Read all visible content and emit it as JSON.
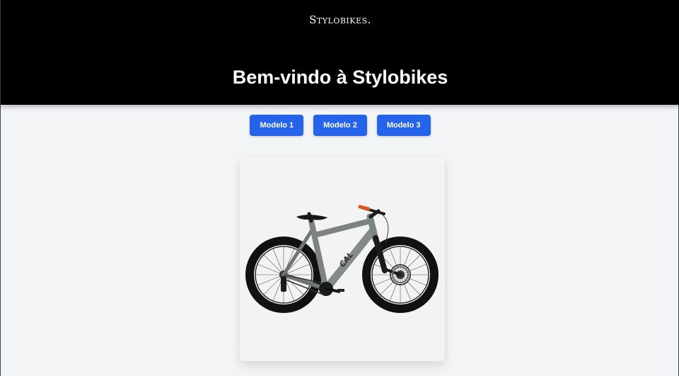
{
  "brand": {
    "logo_text": "Stylobikes."
  },
  "hero": {
    "title": "Bem-vindo à Stylobikes"
  },
  "nav": {
    "buttons": [
      {
        "label": "Modelo 1"
      },
      {
        "label": "Modelo 2"
      },
      {
        "label": "Modelo 3"
      }
    ]
  },
  "product": {
    "image": "mountain-bike-image"
  },
  "colors": {
    "header_bg": "#000000",
    "page_bg": "#f3f4f6",
    "accent": "#2563eb",
    "frame": "#7d8283"
  }
}
